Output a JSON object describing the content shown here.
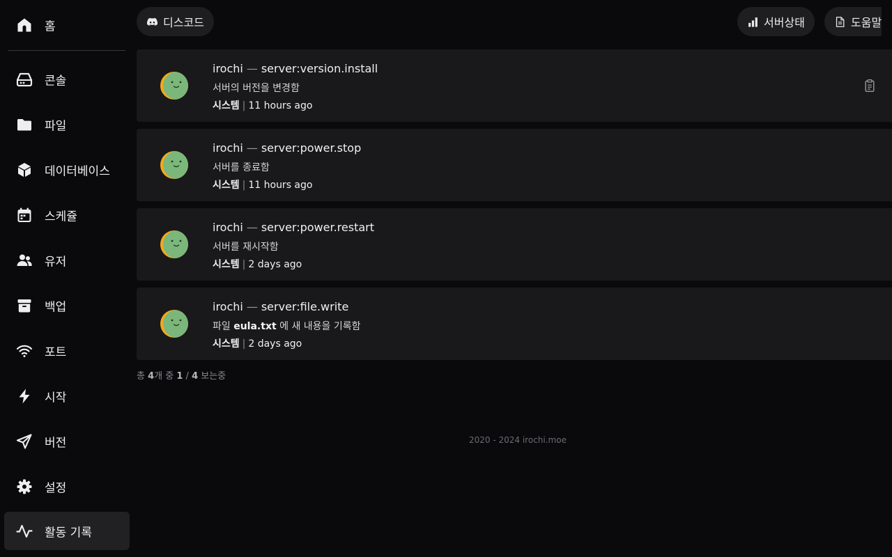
{
  "sidebar": {
    "items": [
      {
        "label": "홈",
        "icon": "home-icon"
      },
      {
        "label": "콘솔",
        "icon": "drive-icon"
      },
      {
        "label": "파일",
        "icon": "folder-icon"
      },
      {
        "label": "데이터베이스",
        "icon": "cube-icon"
      },
      {
        "label": "스케쥴",
        "icon": "calendar-icon"
      },
      {
        "label": "유저",
        "icon": "users-icon"
      },
      {
        "label": "백업",
        "icon": "archive-icon"
      },
      {
        "label": "포트",
        "icon": "wifi-icon"
      },
      {
        "label": "시작",
        "icon": "lightning-icon"
      },
      {
        "label": "버전",
        "icon": "paper-plane-icon"
      },
      {
        "label": "설정",
        "icon": "cog-icon"
      },
      {
        "label": "활동 기록",
        "icon": "activity-icon",
        "active": true
      }
    ]
  },
  "header": {
    "discord_label": "디스코드",
    "status_label": "서버상태",
    "help_label": "도움말"
  },
  "logs": [
    {
      "user": "irochi",
      "sep": "—",
      "event": "server:version.install",
      "description": "서버의 버전을 변경함",
      "actor": "시스템",
      "time": "11 hours ago",
      "has_clipboard": true
    },
    {
      "user": "irochi",
      "sep": "—",
      "event": "server:power.stop",
      "description": "서버를 종료함",
      "actor": "시스템",
      "time": "11 hours ago"
    },
    {
      "user": "irochi",
      "sep": "—",
      "event": "server:power.restart",
      "description": "서버를 재시작함",
      "actor": "시스템",
      "time": "2 days ago"
    },
    {
      "user": "irochi",
      "sep": "—",
      "event": "server:file.write",
      "description_prefix": "파일",
      "description_file": "eula.txt",
      "description_suffix": "에 새 내용을 기록함",
      "actor": "시스템",
      "time": "2 days ago"
    }
  ],
  "pagination": {
    "prefix": "총",
    "total": "4",
    "unit_word": "개 중",
    "from": "1",
    "slash": "/",
    "to": "4",
    "suffix": "보는중"
  },
  "footer": {
    "text": "2020 - 2024 irochi.moe"
  },
  "colors": {
    "avatar_green": "#7bb77a",
    "avatar_orange": "#f2a91c",
    "background": "#0a090b",
    "card": "#19191b"
  }
}
